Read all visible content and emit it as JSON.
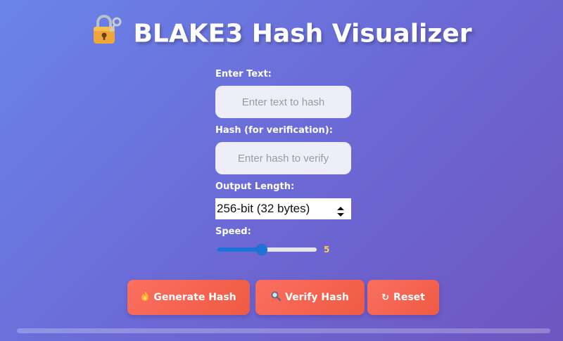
{
  "header": {
    "icon": "lock-with-key-icon",
    "title": "BLAKE3 Hash Visualizer"
  },
  "form": {
    "text_label": "Enter Text:",
    "text_placeholder": "Enter text to hash",
    "hash_label": "Hash (for verification):",
    "hash_placeholder": "Enter hash to verify",
    "output_label": "Output Length:",
    "output_selected": "256-bit (32 bytes)",
    "speed_label": "Speed:",
    "speed_value": "5",
    "speed_min": 1,
    "speed_max": 10
  },
  "buttons": {
    "generate": {
      "icon": "fire-icon",
      "label": "Generate Hash"
    },
    "verify": {
      "icon": "magnifier-icon",
      "label": "Verify Hash"
    },
    "reset": {
      "icon": "refresh-icon",
      "label": "Reset"
    }
  },
  "colors": {
    "accent": "#1e74d6",
    "button": "#f2604b",
    "speed_value": "#f5d44a"
  }
}
